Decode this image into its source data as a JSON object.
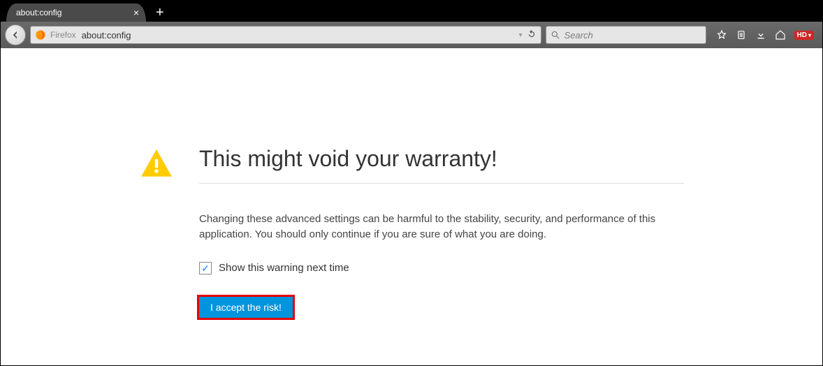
{
  "tabs": {
    "active": {
      "title": "about:config"
    }
  },
  "urlbar": {
    "identity_label": "Firefox",
    "url": "about:config"
  },
  "search": {
    "placeholder": "Search"
  },
  "toolbar_badge": "HD",
  "warning": {
    "title": "This might void your warranty!",
    "body": "Changing these advanced settings can be harmful to the stability, security, and performance of this application. You should only continue if you are sure of what you are doing.",
    "checkbox_label": "Show this warning next time",
    "checkbox_checked": true,
    "accept_label": "I accept the risk!"
  }
}
